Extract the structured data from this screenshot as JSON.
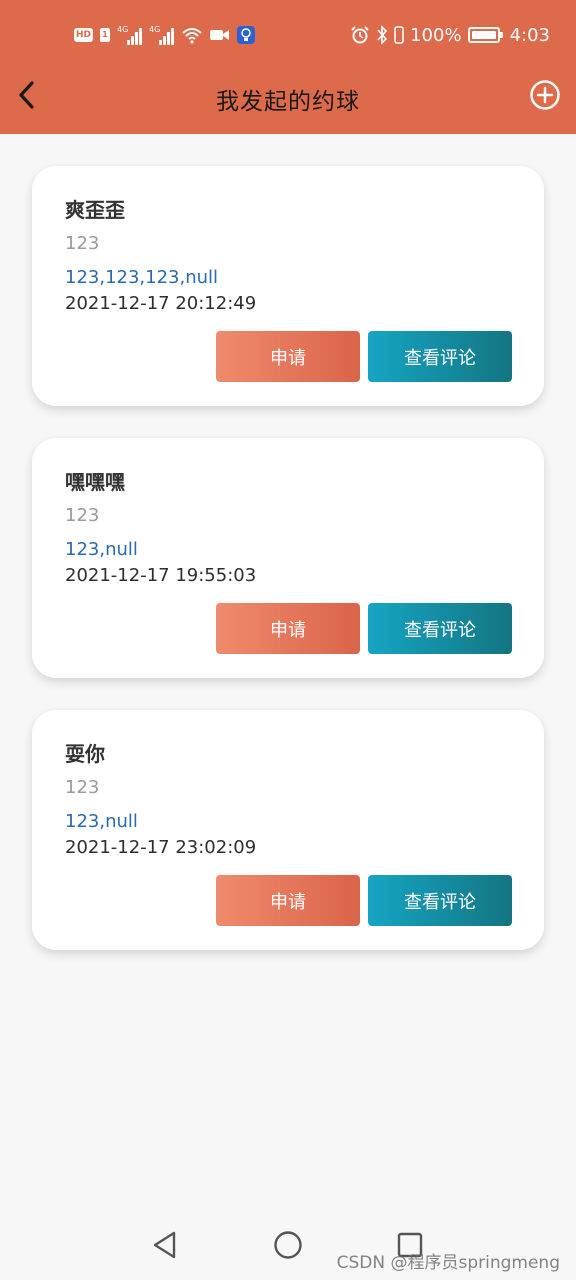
{
  "status_bar": {
    "hd_label": "HD",
    "sim_label": "1",
    "network_label": "4G",
    "battery_percent": "100%",
    "time": "4:03"
  },
  "app_bar": {
    "title": "我发起的约球"
  },
  "cards": [
    {
      "title": "爽歪歪",
      "subtitle": "123",
      "players": "123,123,123,null",
      "datetime": "2021-12-17 20:12:49",
      "apply_label": "申请",
      "comments_label": "查看评论"
    },
    {
      "title": "嘿嘿嘿",
      "subtitle": "123",
      "players": "123,null",
      "datetime": "2021-12-17 19:55:03",
      "apply_label": "申请",
      "comments_label": "查看评论"
    },
    {
      "title": "耍你",
      "subtitle": "123",
      "players": "123,null",
      "datetime": "2021-12-17 23:02:09",
      "apply_label": "申请",
      "comments_label": "查看评论"
    }
  ],
  "watermark": "CSDN @程序员springmeng",
  "icons": {
    "back": "chevron-left-icon",
    "add": "plus-circle-icon",
    "nav_back": "triangle-back-icon",
    "nav_home": "circle-home-icon",
    "nav_recents": "square-recents-icon"
  },
  "colors": {
    "header": "#dd6a4a",
    "apply_button": "#e6765a",
    "comments_button": "#1592a8",
    "players_text": "#2a6ab0"
  }
}
